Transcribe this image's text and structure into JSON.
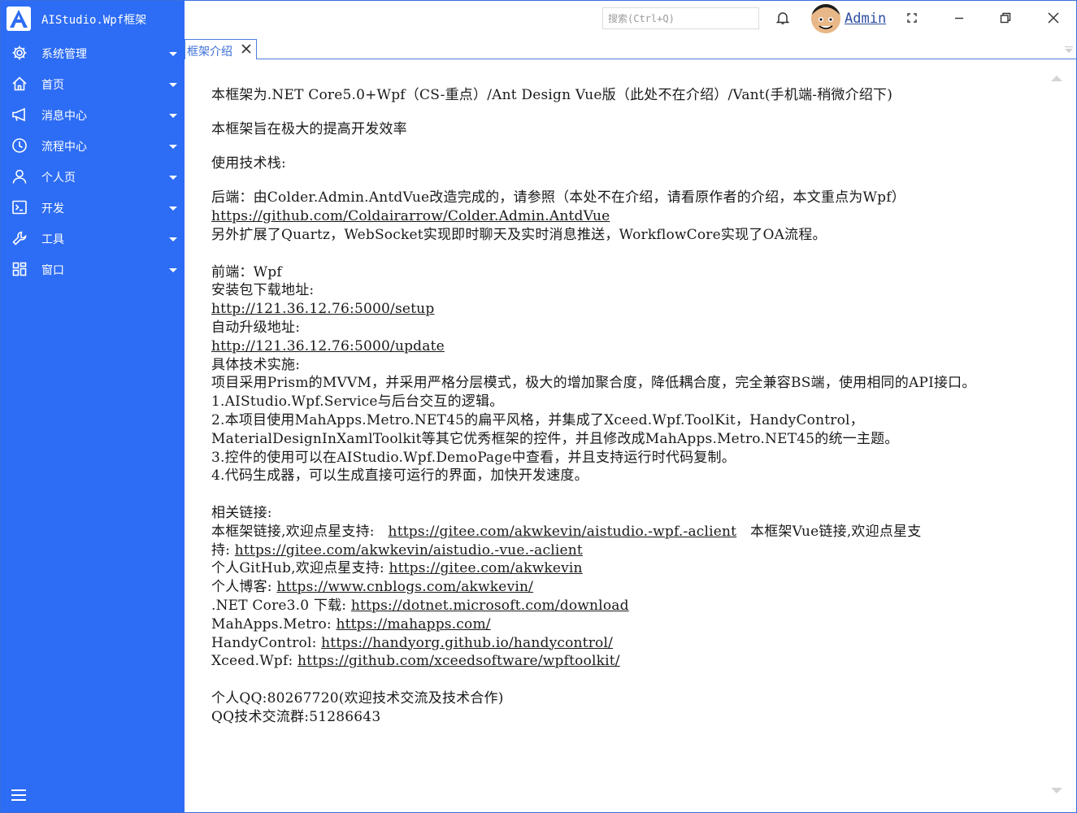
{
  "app": {
    "title": "AIStudio.Wpf框架",
    "logo_letter": "A"
  },
  "sidebar": {
    "items": [
      {
        "label": "系统管理",
        "icon": "gear-icon"
      },
      {
        "label": "首页",
        "icon": "home-icon"
      },
      {
        "label": "消息中心",
        "icon": "megaphone-icon"
      },
      {
        "label": "流程中心",
        "icon": "clock-icon"
      },
      {
        "label": "个人页",
        "icon": "user-icon"
      },
      {
        "label": "开发",
        "icon": "terminal-icon"
      },
      {
        "label": "工具",
        "icon": "wrench-icon"
      },
      {
        "label": "窗口",
        "icon": "windows-icon"
      }
    ]
  },
  "header": {
    "search_placeholder": "搜索(Ctrl+Q)",
    "username": "Admin"
  },
  "tabs": [
    {
      "label": "框架介绍"
    }
  ],
  "content": {
    "intro1": "本框架为.NET Core5.0+Wpf（CS-重点）/Ant Design Vue版（此处不在介绍）/Vant(手机端-稍微介绍下)",
    "intro2": "本框架旨在极大的提高开发效率",
    "stack_title": "使用技术栈:",
    "backend_line": "后端：由Colder.Admin.AntdVue改造完成的，请参照（本处不在介绍，请看原作者的介绍，本文重点为Wpf）",
    "backend_link": "https://github.com/Coldairarrow/Colder.Admin.AntdVue",
    "backend_ext": "另外扩展了Quartz，WebSocket实现即时聊天及实时消息推送，WorkflowCore实现了OA流程。",
    "frontend_title": "前端：Wpf",
    "setup_label": "安装包下载地址:",
    "setup_link": "http://121.36.12.76:5000/setup",
    "update_label": "自动升级地址:",
    "update_link": "http://121.36.12.76:5000/update",
    "impl_title": "具体技术实施:",
    "impl_body": "项目采用Prism的MVVM，并采用严格分层模式，极大的增加聚合度，降低耦合度，完全兼容BS端，使用相同的API接口。",
    "item1": "1.AIStudio.Wpf.Service与后台交互的逻辑。",
    "item2": "2.本项目使用MahApps.Metro.NET45的扁平风格，并集成了Xceed.Wpf.ToolKit，HandyControl，MaterialDesignInXamlToolkit等其它优秀框架的控件，并且修改成MahApps.Metro.NET45的统一主题。",
    "item3": "3.控件的使用可以在AIStudio.Wpf.DemoPage中查看，并且支持运行时代码复制。",
    "item4": "4.代码生成器，可以生成直接可运行的界面，加快开发速度。",
    "links_title": "相关链接:",
    "star_label": "本框架链接,欢迎点星支持:",
    "star_link": "https://gitee.com/akwkevin/aistudio.-wpf.-aclient",
    "vue_label": "本框架Vue链接,欢迎点星支持:",
    "vue_link": "https://gitee.com/akwkevin/aistudio.-vue.-aclient",
    "github_label": "个人GitHub,欢迎点星支持:",
    "github_link": "https://gitee.com/akwkevin",
    "blog_label": "个人博客:",
    "blog_link": "https://www.cnblogs.com/akwkevin/",
    "dotnet_label": ".NET Core3.0 下载:",
    "dotnet_link": "https://dotnet.microsoft.com/download",
    "mahapps_label": "MahApps.Metro:",
    "mahapps_link": "https://mahapps.com/",
    "handy_label": "HandyControl:",
    "handy_link": "https://handyorg.github.io/handycontrol/",
    "xceed_label": "Xceed.Wpf:",
    "xceed_link": "https://github.com/xceedsoftware/wpftoolkit/",
    "qq": "个人QQ:80267720(欢迎技术交流及技术合作)",
    "qq_group": "QQ技术交流群:51286643"
  },
  "colors": {
    "sidebar_bg": "#2d6cf4",
    "accent": "#3c6fd8"
  }
}
